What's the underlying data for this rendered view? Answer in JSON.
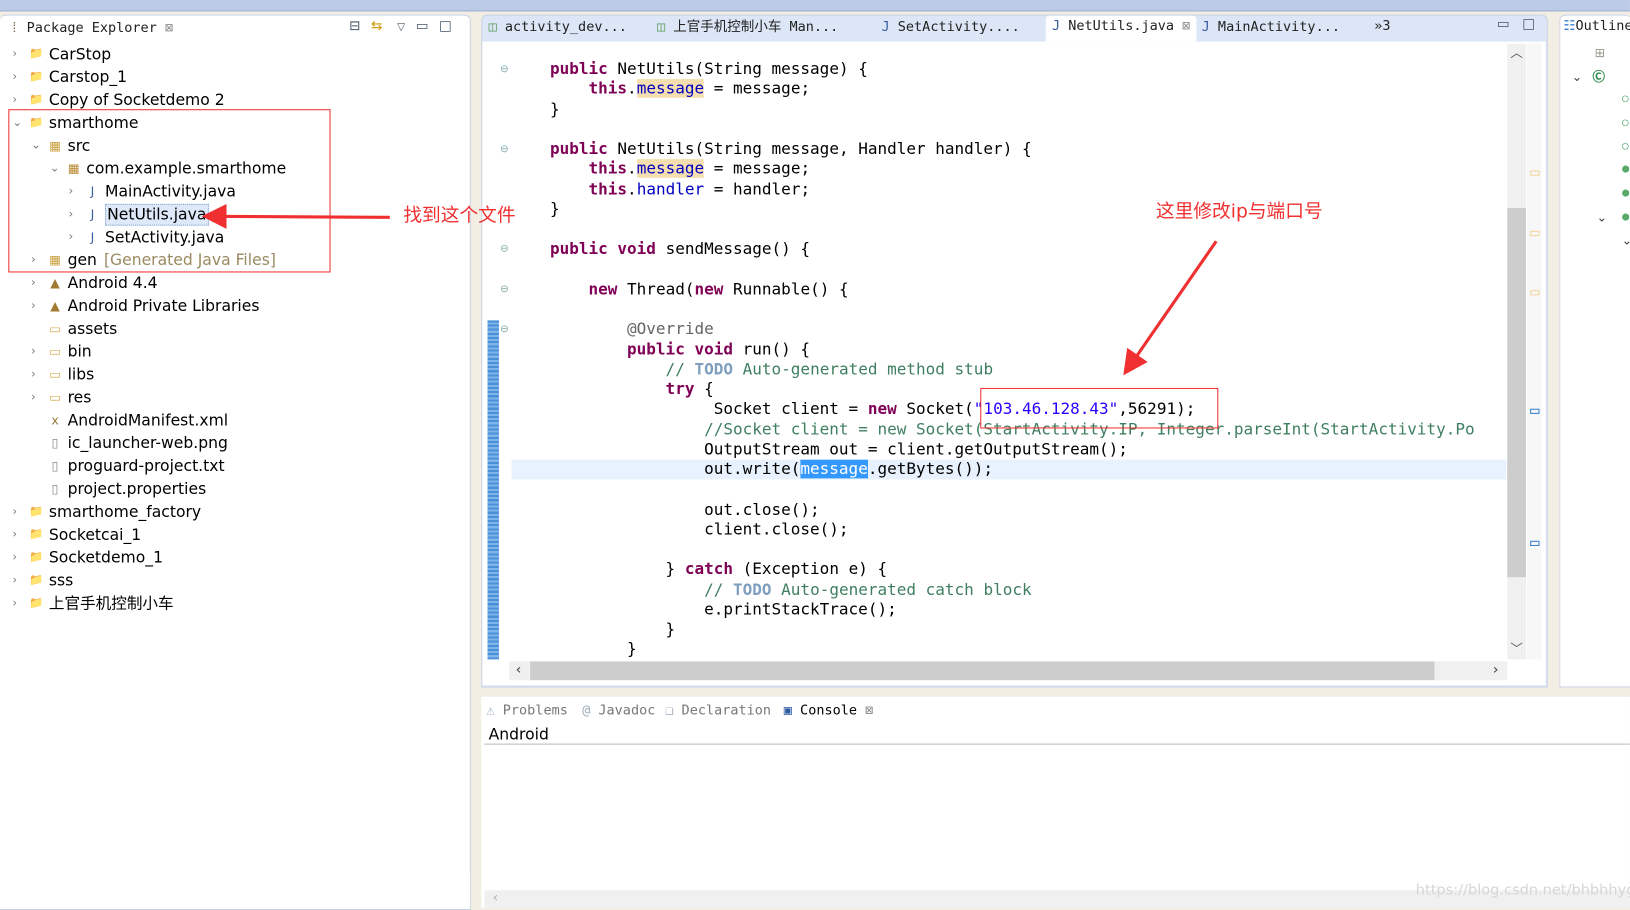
{
  "package_explorer": {
    "title": "Package Explorer",
    "items": [
      {
        "label": "CarStop",
        "level": 0,
        "arrow": "›",
        "icon": "project"
      },
      {
        "label": "Carstop_1",
        "level": 0,
        "arrow": "›",
        "icon": "project"
      },
      {
        "label": "Copy of Socketdemo 2",
        "level": 0,
        "arrow": "›",
        "icon": "project"
      },
      {
        "label": "smarthome",
        "level": 0,
        "arrow": "⌄",
        "icon": "project"
      },
      {
        "label": "src",
        "level": 1,
        "arrow": "⌄",
        "icon": "source-folder"
      },
      {
        "label": "com.example.smarthome",
        "level": 2,
        "arrow": "⌄",
        "icon": "package"
      },
      {
        "label": "MainActivity.java",
        "level": 3,
        "arrow": "›",
        "icon": "java-file"
      },
      {
        "label": "NetUtils.java",
        "level": 3,
        "arrow": "›",
        "icon": "java-file",
        "selected": true
      },
      {
        "label": "SetActivity.java",
        "level": 3,
        "arrow": "›",
        "icon": "java-file"
      },
      {
        "label": "gen",
        "suffix": "[Generated Java Files]",
        "level": 1,
        "arrow": "›",
        "icon": "source-folder"
      },
      {
        "label": "Android 4.4",
        "level": 1,
        "arrow": "›",
        "icon": "library"
      },
      {
        "label": "Android Private Libraries",
        "level": 1,
        "arrow": "›",
        "icon": "library"
      },
      {
        "label": "assets",
        "level": 1,
        "arrow": "",
        "icon": "folder"
      },
      {
        "label": "bin",
        "level": 1,
        "arrow": "›",
        "icon": "folder"
      },
      {
        "label": "libs",
        "level": 1,
        "arrow": "›",
        "icon": "folder"
      },
      {
        "label": "res",
        "level": 1,
        "arrow": "›",
        "icon": "folder"
      },
      {
        "label": "AndroidManifest.xml",
        "level": 1,
        "arrow": "",
        "icon": "xml-file"
      },
      {
        "label": "ic_launcher-web.png",
        "level": 1,
        "arrow": "",
        "icon": "file"
      },
      {
        "label": "proguard-project.txt",
        "level": 1,
        "arrow": "",
        "icon": "file"
      },
      {
        "label": "project.properties",
        "level": 1,
        "arrow": "",
        "icon": "file"
      },
      {
        "label": "smarthome_factory",
        "level": 0,
        "arrow": "›",
        "icon": "project"
      },
      {
        "label": "Socketcai_1",
        "level": 0,
        "arrow": "›",
        "icon": "project"
      },
      {
        "label": "Socketdemo_1",
        "level": 0,
        "arrow": "›",
        "icon": "project"
      },
      {
        "label": "sss",
        "level": 0,
        "arrow": "›",
        "icon": "project"
      },
      {
        "label": "上官手机控制小车",
        "level": 0,
        "arrow": "›",
        "icon": "project"
      }
    ]
  },
  "editor": {
    "tabs": [
      {
        "label": "activity_dev...",
        "icon": "xml-file"
      },
      {
        "label": "上官手机控制小车 Man...",
        "icon": "xml-file"
      },
      {
        "label": "SetActivity....",
        "icon": "java-file"
      },
      {
        "label": "NetUtils.java",
        "icon": "java-file",
        "active": true
      },
      {
        "label": "MainActivity...",
        "icon": "java-file"
      }
    ],
    "overflow": "»3",
    "code": [
      [
        [
          "p",
          "    "
        ],
        [
          "kw",
          "public"
        ],
        [
          "p",
          " NetUtils(String message) {"
        ]
      ],
      [
        [
          "p",
          "        "
        ],
        [
          "kw",
          "this"
        ],
        [
          "p",
          "."
        ],
        [
          "fld hl",
          "message"
        ],
        [
          "p",
          " = message;"
        ]
      ],
      [
        [
          "p",
          "    }"
        ]
      ],
      [],
      [
        [
          "p",
          "    "
        ],
        [
          "kw",
          "public"
        ],
        [
          "p",
          " NetUtils(String message, Handler handler) {"
        ]
      ],
      [
        [
          "p",
          "        "
        ],
        [
          "kw",
          "this"
        ],
        [
          "p",
          "."
        ],
        [
          "fld hl",
          "message"
        ],
        [
          "p",
          " = message;"
        ]
      ],
      [
        [
          "p",
          "        "
        ],
        [
          "kw",
          "this"
        ],
        [
          "p",
          "."
        ],
        [
          "fld",
          "handler"
        ],
        [
          "p",
          " = handler;"
        ]
      ],
      [
        [
          "p",
          "    }"
        ]
      ],
      [],
      [
        [
          "p",
          "    "
        ],
        [
          "kw",
          "public void"
        ],
        [
          "p",
          " sendMessage() {"
        ]
      ],
      [],
      [
        [
          "p",
          "        "
        ],
        [
          "kw",
          "new"
        ],
        [
          "p",
          " Thread("
        ],
        [
          "kw",
          "new"
        ],
        [
          "p",
          " Runnable() {"
        ]
      ],
      [],
      [
        [
          "p",
          "            "
        ],
        [
          "ann",
          "@Override"
        ]
      ],
      [
        [
          "p",
          "            "
        ],
        [
          "kw",
          "public void"
        ],
        [
          "p",
          " run() {"
        ]
      ],
      [
        [
          "p",
          "                "
        ],
        [
          "cm",
          "// "
        ],
        [
          "todo",
          "TODO"
        ],
        [
          "cm",
          " Auto-generated method stub"
        ]
      ],
      [
        [
          "p",
          "                "
        ],
        [
          "kw",
          "try"
        ],
        [
          "p",
          " {"
        ]
      ],
      [
        [
          "p",
          "                     Socket client = "
        ],
        [
          "kw",
          "new"
        ],
        [
          "p",
          " Socket("
        ],
        [
          "str",
          "\"103.46.128.43\""
        ],
        [
          "p",
          ",56291);"
        ]
      ],
      [
        [
          "p",
          "                    "
        ],
        [
          "cm",
          "//Socket client = new Socket(StartActivity.IP, Integer.parseInt(StartActivity.Po"
        ]
      ],
      [
        [
          "p",
          "                    OutputStream out = client.getOutputStream();"
        ]
      ],
      [
        [
          "p",
          "                    out.write("
        ],
        [
          "fld sel",
          "message"
        ],
        [
          "p",
          ".getBytes());"
        ]
      ],
      [],
      [
        [
          "p",
          "                    out.close();"
        ]
      ],
      [
        [
          "p",
          "                    client.close();"
        ]
      ],
      [],
      [
        [
          "p",
          "                } "
        ],
        [
          "kw",
          "catch"
        ],
        [
          "p",
          " (Exception e) {"
        ]
      ],
      [
        [
          "p",
          "                    "
        ],
        [
          "cm",
          "// "
        ],
        [
          "todo",
          "TODO"
        ],
        [
          "cm",
          " Auto-generated catch block"
        ]
      ],
      [
        [
          "p",
          "                    e.printStackTrace();"
        ]
      ],
      [
        [
          "p",
          "                }"
        ]
      ],
      [
        [
          "p",
          "            }"
        ]
      ]
    ],
    "current_line": 20
  },
  "outline": {
    "title": "Outline"
  },
  "bottom_panel": {
    "tabs": [
      {
        "label": "Problems",
        "icon": "problems"
      },
      {
        "label": "Javadoc",
        "icon": "at"
      },
      {
        "label": "Declaration",
        "icon": "declaration"
      },
      {
        "label": "Console",
        "icon": "console",
        "active": true
      }
    ],
    "console_text": "Android"
  },
  "annotations": {
    "find_file": "找到这个文件",
    "modify_ip": "这里修改ip与端口号",
    "color": "#f03030"
  },
  "watermark": "https://blog.csdn.net/bhbhhyg"
}
